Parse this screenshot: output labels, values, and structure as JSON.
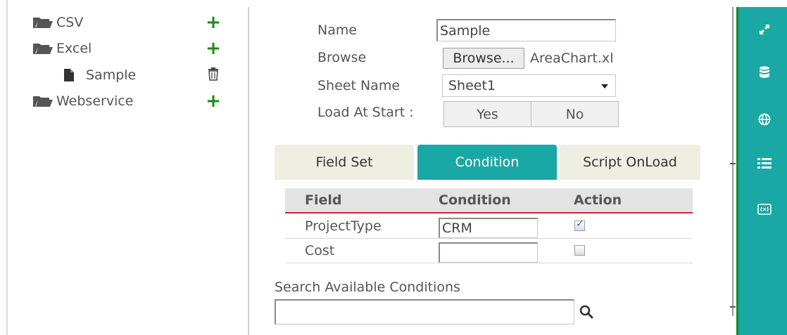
{
  "tree": {
    "items": [
      {
        "label": "CSV",
        "icon": "folder-icon",
        "action": "add"
      },
      {
        "label": "Excel",
        "icon": "folder-icon",
        "action": "add"
      },
      {
        "label": "Sample",
        "icon": "file-icon",
        "action": "delete"
      },
      {
        "label": "Webservice",
        "icon": "folder-icon",
        "action": "add"
      }
    ],
    "add_icon": "plus-icon",
    "delete_icon": "trash-icon",
    "add_color": "#1d8a1d"
  },
  "form": {
    "name_label": "Name",
    "name_value": "Sample",
    "browse_label": "Browse",
    "browse_button": "Browse...",
    "file_name": "AreaChart.xl",
    "sheet_label": "Sheet Name",
    "sheet_value": "Sheet1",
    "load_label": "Load At Start :",
    "load_options": [
      "Yes",
      "No"
    ]
  },
  "tabs": [
    {
      "label": "Field Set",
      "active": false
    },
    {
      "label": "Condition",
      "active": true
    },
    {
      "label": "Script OnLoad",
      "active": false
    }
  ],
  "conditions_table": {
    "headers": [
      "Field",
      "Condition",
      "Action"
    ],
    "rows": [
      {
        "field": "ProjectType",
        "condition": "CRM",
        "action_checked": true
      },
      {
        "field": "Cost",
        "condition": "",
        "action_checked": false
      }
    ],
    "header_underline_color": "#c8282d"
  },
  "search": {
    "label": "Search Available Conditions",
    "value": "",
    "icon": "search-icon"
  },
  "toolbar": {
    "icons": [
      "expand-icon",
      "database-icon",
      "globe-icon",
      "list-icon",
      "formula-icon"
    ],
    "color": "#1aa8a5"
  },
  "colors": {
    "accent": "#1aa8a5",
    "tab_inactive": "#eeeee2"
  }
}
